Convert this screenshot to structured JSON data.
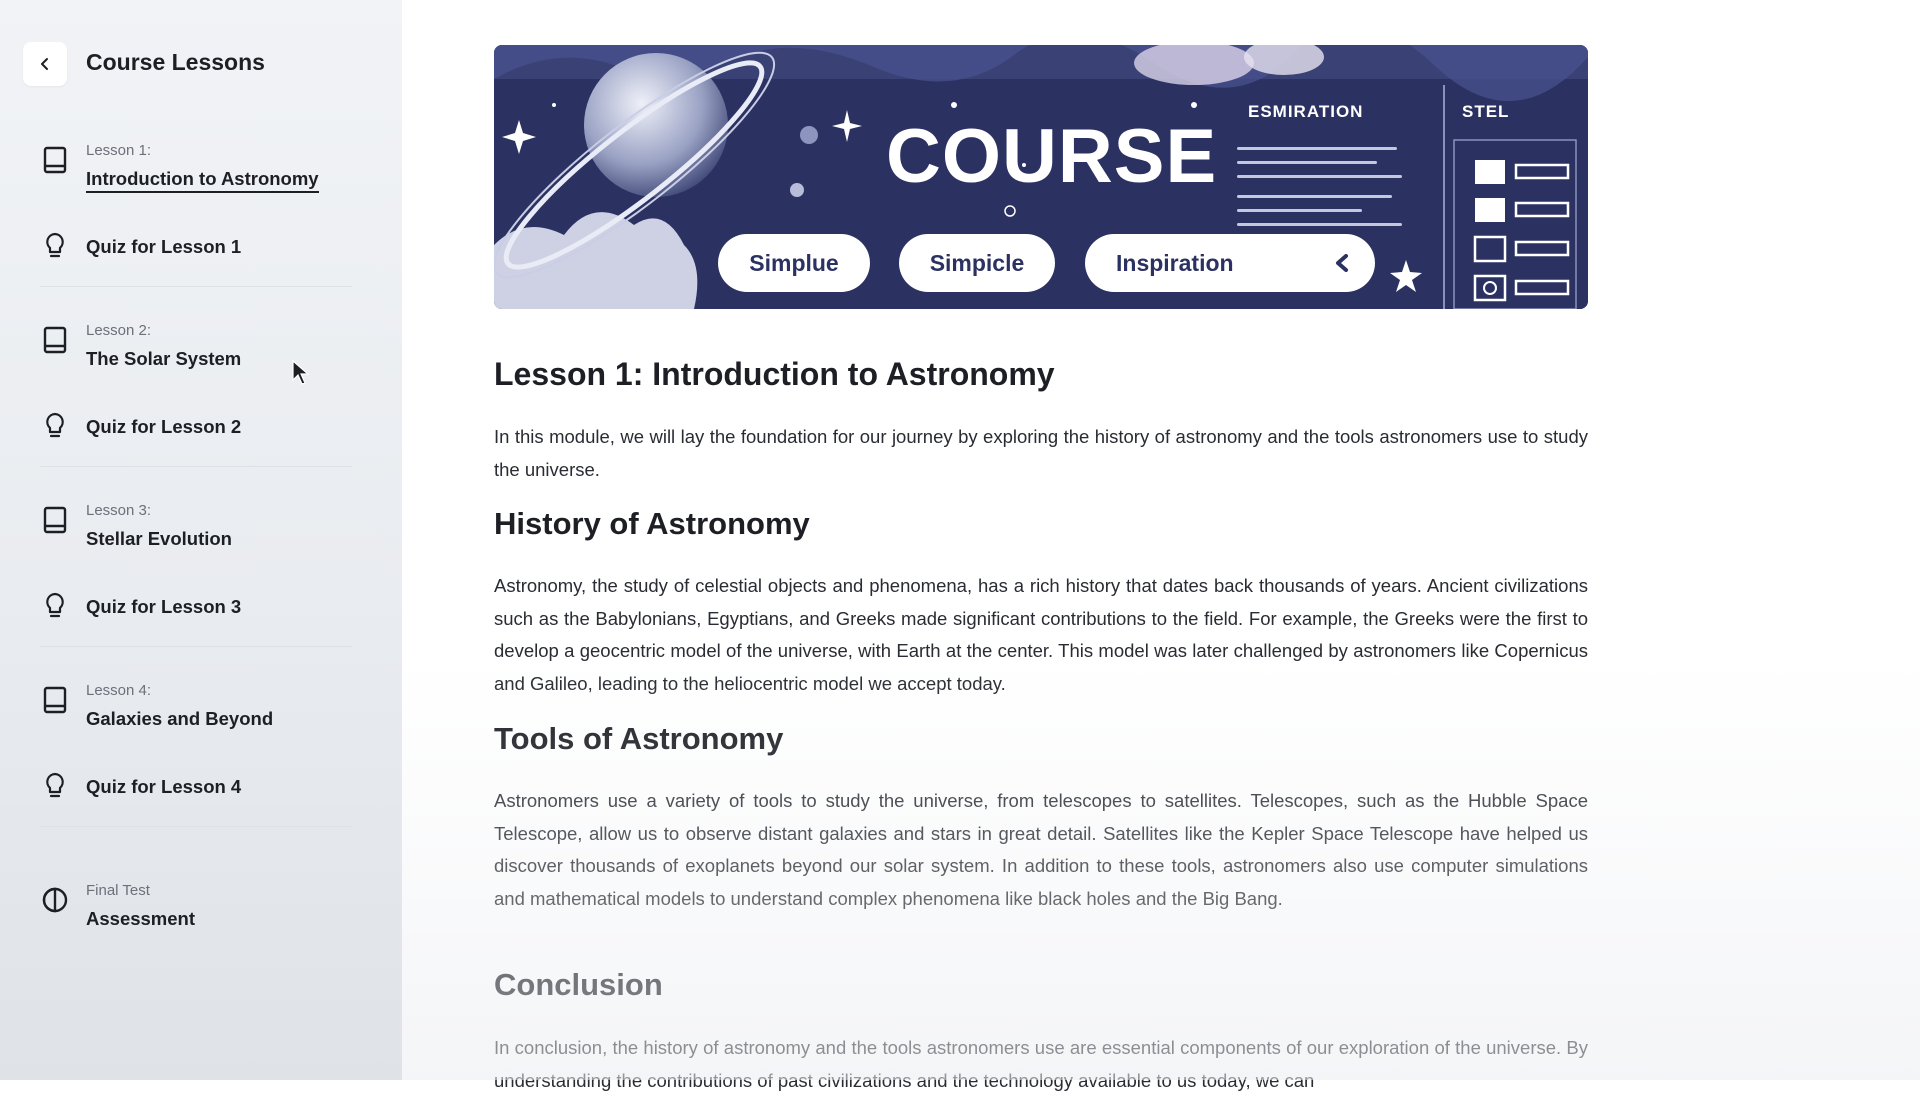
{
  "sidebar": {
    "title": "Course Lessons",
    "items": [
      {
        "kicker": "Lesson 1:",
        "label": "Introduction to Astronomy",
        "icon": "book-icon"
      },
      {
        "label": "Quiz for Lesson 1",
        "icon": "lightbulb-icon"
      },
      {
        "kicker": "Lesson 2:",
        "label": "The Solar System",
        "icon": "book-icon"
      },
      {
        "label": "Quiz for Lesson 2",
        "icon": "lightbulb-icon"
      },
      {
        "kicker": "Lesson 3:",
        "label": "Stellar Evolution",
        "icon": "book-icon"
      },
      {
        "label": "Quiz for Lesson 3",
        "icon": "lightbulb-icon"
      },
      {
        "kicker": "Lesson 4:",
        "label": "Galaxies and Beyond",
        "icon": "book-icon"
      },
      {
        "label": "Quiz for Lesson 4",
        "icon": "lightbulb-icon"
      },
      {
        "kicker": "Final Test",
        "label": "Assessment",
        "icon": "half-circle-icon"
      }
    ]
  },
  "banner": {
    "title": "COURSE",
    "label_left": "ESMIRATION",
    "label_right": "STEL",
    "pills": [
      "Simplue",
      "Simpicle",
      "Inspiration"
    ]
  },
  "article": {
    "title": "Lesson 1: Introduction to Astronomy",
    "intro": "In this module, we will lay the foundation for our journey by exploring the history of astronomy and the tools astronomers use to study the universe.",
    "sections": [
      {
        "heading": "History of Astronomy",
        "body": "Astronomy, the study of celestial objects and phenomena, has a rich history that dates back thousands of years. Ancient civilizations such as the Babylonians, Egyptians, and Greeks made significant contributions to the field. For example, the Greeks were the first to develop a geocentric model of the universe, with Earth at the center. This model was later challenged by astronomers like Copernicus and Galileo, leading to the heliocentric model we accept today."
      },
      {
        "heading": "Tools of Astronomy",
        "body": "Astronomers use a variety of tools to study the universe, from telescopes to satellites. Telescopes, such as the Hubble Space Telescope, allow us to observe distant galaxies and stars in great detail. Satellites like the Kepler Space Telescope have helped us discover thousands of exoplanets beyond our solar system. In addition to these tools, astronomers also use computer simulations and mathematical models to understand complex phenomena like black holes and the Big Bang."
      },
      {
        "heading": "Conclusion",
        "body": "In conclusion, the history of astronomy and the tools astronomers use are essential components of our exploration of the universe. By understanding the contributions of past civilizations and the technology available to us today, we can"
      }
    ]
  },
  "colors": {
    "banner_bg": "#2b3262",
    "sidebar_bg": "#eceef2",
    "text": "#1d1f25"
  }
}
